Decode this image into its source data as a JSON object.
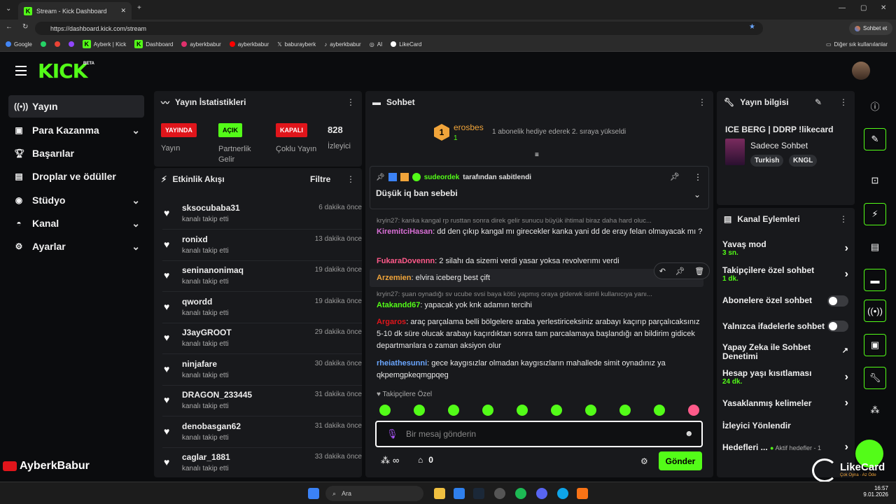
{
  "browser": {
    "tab_title": "Stream - Kick Dashboard",
    "url": "https://dashboard.kick.com/stream",
    "chat_button": "Sohbet et",
    "bookmarks": [
      "Google",
      "Ayberk | Kick",
      "Dashboard",
      "ayberkbabur",
      "ayberkbabur",
      "baburayberk",
      "ayberkbabur",
      "AI",
      "LikeCard"
    ],
    "other_bookmarks": "Diğer sık kullanılanlar"
  },
  "app": {
    "logo": "KICK",
    "beta": "BETA"
  },
  "sidebar": {
    "items": [
      {
        "label": "Yayın",
        "icon": "broadcast-icon"
      },
      {
        "label": "Para Kazanma",
        "icon": "money-icon"
      },
      {
        "label": "Başarılar",
        "icon": "trophy-icon"
      },
      {
        "label": "Droplar ve ödüller",
        "icon": "gift-icon"
      },
      {
        "label": "Stüdyo",
        "icon": "studio-icon"
      },
      {
        "label": "Kanal",
        "icon": "person-icon"
      },
      {
        "label": "Ayarlar",
        "icon": "gear-icon"
      }
    ]
  },
  "stats": {
    "title": "Yayın İstatistikleri",
    "badges": [
      {
        "value": "YAYINDA",
        "label": "Yayın",
        "color": "#e0151b"
      },
      {
        "value": "AÇIK",
        "label": "Partnerlik Gelir",
        "color": "#53fc18"
      },
      {
        "value": "KAPALI",
        "label": "Çoklu Yayın",
        "color": "#e0151b"
      }
    ],
    "viewers": "828",
    "viewers_label": "İzleyici"
  },
  "activity": {
    "title": "Etkinlik Akışı",
    "filter": "Filtre",
    "items": [
      {
        "name": "sksocubaba31",
        "action": "kanalı takip etti",
        "time": "6 dakika önce"
      },
      {
        "name": "ronixd",
        "action": "kanalı takip etti",
        "time": "13 dakika önce"
      },
      {
        "name": "seninanonimaq",
        "action": "kanalı takip etti",
        "time": "19 dakika önce"
      },
      {
        "name": "qwordd",
        "action": "kanalı takip etti",
        "time": "19 dakika önce"
      },
      {
        "name": "J3ayGROOT",
        "action": "kanalı takip etti",
        "time": "29 dakika önce"
      },
      {
        "name": "ninjafare",
        "action": "kanalı takip etti",
        "time": "30 dakika önce"
      },
      {
        "name": "DRAGON_233445",
        "action": "kanalı takip etti",
        "time": "31 dakika önce"
      },
      {
        "name": "denobasgan62",
        "action": "kanalı takip etti",
        "time": "31 dakika önce"
      },
      {
        "name": "caglar_1881",
        "action": "kanalı takip etti",
        "time": "33 dakika önce"
      }
    ]
  },
  "chat": {
    "title": "Sohbet",
    "top_gifter": {
      "rank": "1",
      "name": "erosbes",
      "count": "1",
      "message": "1 abonelik hediye ederek 2. sıraya yükseldi"
    },
    "pinned": {
      "by": "sudeordek",
      "by_suffix": "tarafından sabitlendi",
      "text": "Düşük iq ban sebebi"
    },
    "messages": [
      {
        "reply": "kryin27: kanka kangal rp rusttan sonra direk gelir sunucu büyük ihtimal biraz daha hard oluc...",
        "user": "KiremitciHasan",
        "color": "#d96fd6",
        "text": "dd den çıkıp kangal mı girecekler kanka yani dd de eray felan olmayacak mı ?"
      },
      {
        "user": "FukaraDovennn",
        "color": "#ff5a8a",
        "text": "2 silahı da sizemi verdi yasar yoksa revolverımı verdi"
      },
      {
        "user": "Arzemien",
        "color": "#f0a43a",
        "text": "elvira iceberg best çift"
      },
      {
        "reply": "kryin27: şuan oynadığı sv ucube svsi baya kötü yapmış oraya giderwk isimli kullanıcıya yanı...",
        "user": "Atakandd67",
        "color": "#53fc18",
        "text": "yapacak yok knk adamın tercihi"
      },
      {
        "user": "Argaros",
        "color": "#e0151b",
        "text": "araç parçalama belli bölgelere araba yerlestiriceksiniz arabayı kaçırıp parçalıcaksınız 5-10 dk süre olucak arabayı kaçırdıktan sonra tam parcalamaya başlandığı an bildirim gidicek departmanlara o zaman aksiyon olur"
      },
      {
        "user": "rheiathesunni",
        "color": "#6aa6ff",
        "text": "gece kaygısızlar olmadan kaygısızların mahallede simit oynadınız ya qkpemgpkeqmgpqeg"
      }
    ],
    "followers_only": "Takipçilere Özel",
    "input_placeholder": "Bir mesaj gönderin",
    "infinity": "∞",
    "count": "0",
    "send": "Gönder"
  },
  "stream_info": {
    "title": "Yayın bilgisi",
    "stream_title": "ICE BERG | DDRP !likecard",
    "category": "Sadece Sohbet",
    "tags": [
      "Turkish",
      "KNGL"
    ]
  },
  "channel_actions": {
    "title": "Kanal Eylemleri",
    "items": [
      {
        "label": "Yavaş mod",
        "value": "3 sn.",
        "kind": "chevron"
      },
      {
        "label": "Takipçilere özel sohbet",
        "value": "1 dk.",
        "kind": "chevron"
      },
      {
        "label": "Abonelere özel sohbet",
        "value": "",
        "kind": "toggle"
      },
      {
        "label": "Yalnızca ifadelerle sohbet",
        "value": "",
        "kind": "toggle"
      },
      {
        "label": "Yapay Zeka ile Sohbet Denetimi",
        "value": "",
        "kind": "external"
      },
      {
        "label": "Hesap yaşı kısıtlaması",
        "value": "24 dk.",
        "kind": "chevron"
      },
      {
        "label": "Yasaklanmış kelimeler",
        "value": "",
        "kind": "chevron"
      },
      {
        "label": "İzleyici Yönlendir",
        "value": "",
        "kind": "none"
      },
      {
        "label": "Hedefleri ...",
        "value": "Aktif hedefler - 1",
        "kind": "chevron"
      }
    ]
  },
  "overlay": {
    "channel": "AyberkBabur",
    "brand": "LikeCard",
    "brand_sub": "Çok Oyna · Az Öde"
  },
  "taskbar": {
    "search": "Ara",
    "time": "16:57",
    "date": "9.01.2026"
  }
}
